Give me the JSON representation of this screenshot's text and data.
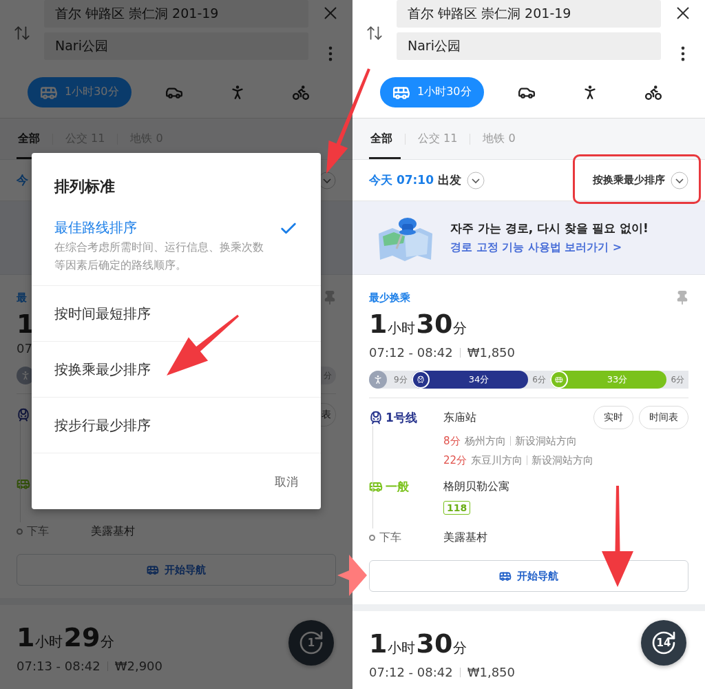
{
  "left_screen": {
    "header": {
      "origin": "首尔 钟路区 崇仁洞 201-19",
      "destination": "Nari公园",
      "modes": [
        {
          "kind": "transit",
          "label": "1小时30分",
          "selected": true
        },
        {
          "kind": "car",
          "selected": false
        },
        {
          "kind": "walk",
          "selected": false
        },
        {
          "kind": "bike",
          "selected": false
        }
      ]
    },
    "tabs": [
      {
        "label": "全部",
        "selected": true
      },
      {
        "label": "公交 11",
        "selected": false
      },
      {
        "label": "地铁 0",
        "selected": false
      }
    ],
    "date_fragment": "今",
    "route_label_fragment": "最",
    "duration_fragment": "1",
    "time_fragment": "07",
    "segment_fragment": "分",
    "step_button_fragment": "表",
    "steps": [
      {
        "kind": "subway"
      },
      {
        "kind": "bus"
      },
      {
        "kind": "alight",
        "line": "下车",
        "stop": "美露基村"
      }
    ],
    "nav_button": "开始导航",
    "next_route": {
      "hours": "1",
      "hour_unit": "小时",
      "minutes": "29",
      "minute_unit": "分",
      "time": "07:13 - 08:42",
      "fare": "₩2,900"
    },
    "fab_count": "1",
    "dialog": {
      "title": "排列标准",
      "options": [
        {
          "label": "最佳路线排序",
          "description": "在综合考虑所需时间、运行信息、换乘次数等因素后确定的路线顺序。",
          "selected": true
        },
        {
          "label": "按时间最短排序",
          "selected": false
        },
        {
          "label": "按换乘最少排序",
          "selected": false
        },
        {
          "label": "按步行最少排序",
          "selected": false
        }
      ],
      "cancel": "取消"
    }
  },
  "right_screen": {
    "header": {
      "origin": "首尔 钟路区 崇仁洞 201-19",
      "destination": "Nari公园",
      "modes": [
        {
          "kind": "transit",
          "label": "1小时30分",
          "selected": true
        },
        {
          "kind": "car",
          "selected": false
        },
        {
          "kind": "walk",
          "selected": false
        },
        {
          "kind": "bike",
          "selected": false
        }
      ]
    },
    "tabs": [
      {
        "label": "全部",
        "selected": true
      },
      {
        "label": "公交 11",
        "selected": false
      },
      {
        "label": "地铁 0",
        "selected": false
      }
    ],
    "departure": {
      "day_time": "今天 07:10",
      "suffix": "出发"
    },
    "sort": "按换乘最少排序",
    "banner": {
      "title": "자주 가는 경로, 다시 찾을 필요 없이!",
      "link": "경로 고정 기능 사용법 보러가기 >"
    },
    "route": {
      "label": "最少换乘",
      "hours": "1",
      "hour_unit": "小时",
      "minutes": "30",
      "minute_unit": "分",
      "time": "07:12 - 08:42",
      "fare": "₩1,850",
      "segments": [
        {
          "kind": "walk",
          "label": "9分",
          "color": "#9aa3b5"
        },
        {
          "kind": "subway",
          "label": "34分",
          "color": "#26338c"
        },
        {
          "kind": "transfer",
          "label": "6分",
          "color": "#e6e8ec"
        },
        {
          "kind": "bus",
          "label": "33分",
          "color": "#7ac21b"
        },
        {
          "kind": "transfer",
          "label": "6分",
          "color": "#e6e8ec"
        }
      ],
      "steps": [
        {
          "kind": "subway",
          "line": "1号线",
          "color": "#26338c",
          "stop": "东庙站",
          "buttons": [
            "实时",
            "时间表"
          ],
          "arrivals": [
            {
              "wait": "8分",
              "direction": "杨州方向",
              "via": "新设洞站方向"
            },
            {
              "wait": "22分",
              "direction": "东豆川方向",
              "via": "新设洞站方向"
            }
          ]
        },
        {
          "kind": "bus",
          "line": "一般",
          "color": "#7ac21b",
          "stop": "格朗贝勒公寓",
          "bus_number": "118"
        },
        {
          "kind": "alight",
          "line": "下车",
          "stop": "美露基村"
        }
      ]
    },
    "nav_button": "开始导航",
    "next_route": {
      "hours": "1",
      "hour_unit": "小时",
      "minutes": "30",
      "minute_unit": "分",
      "time": "07:12 - 08:42",
      "fare": "₩1,850"
    },
    "fab_count": "14"
  }
}
